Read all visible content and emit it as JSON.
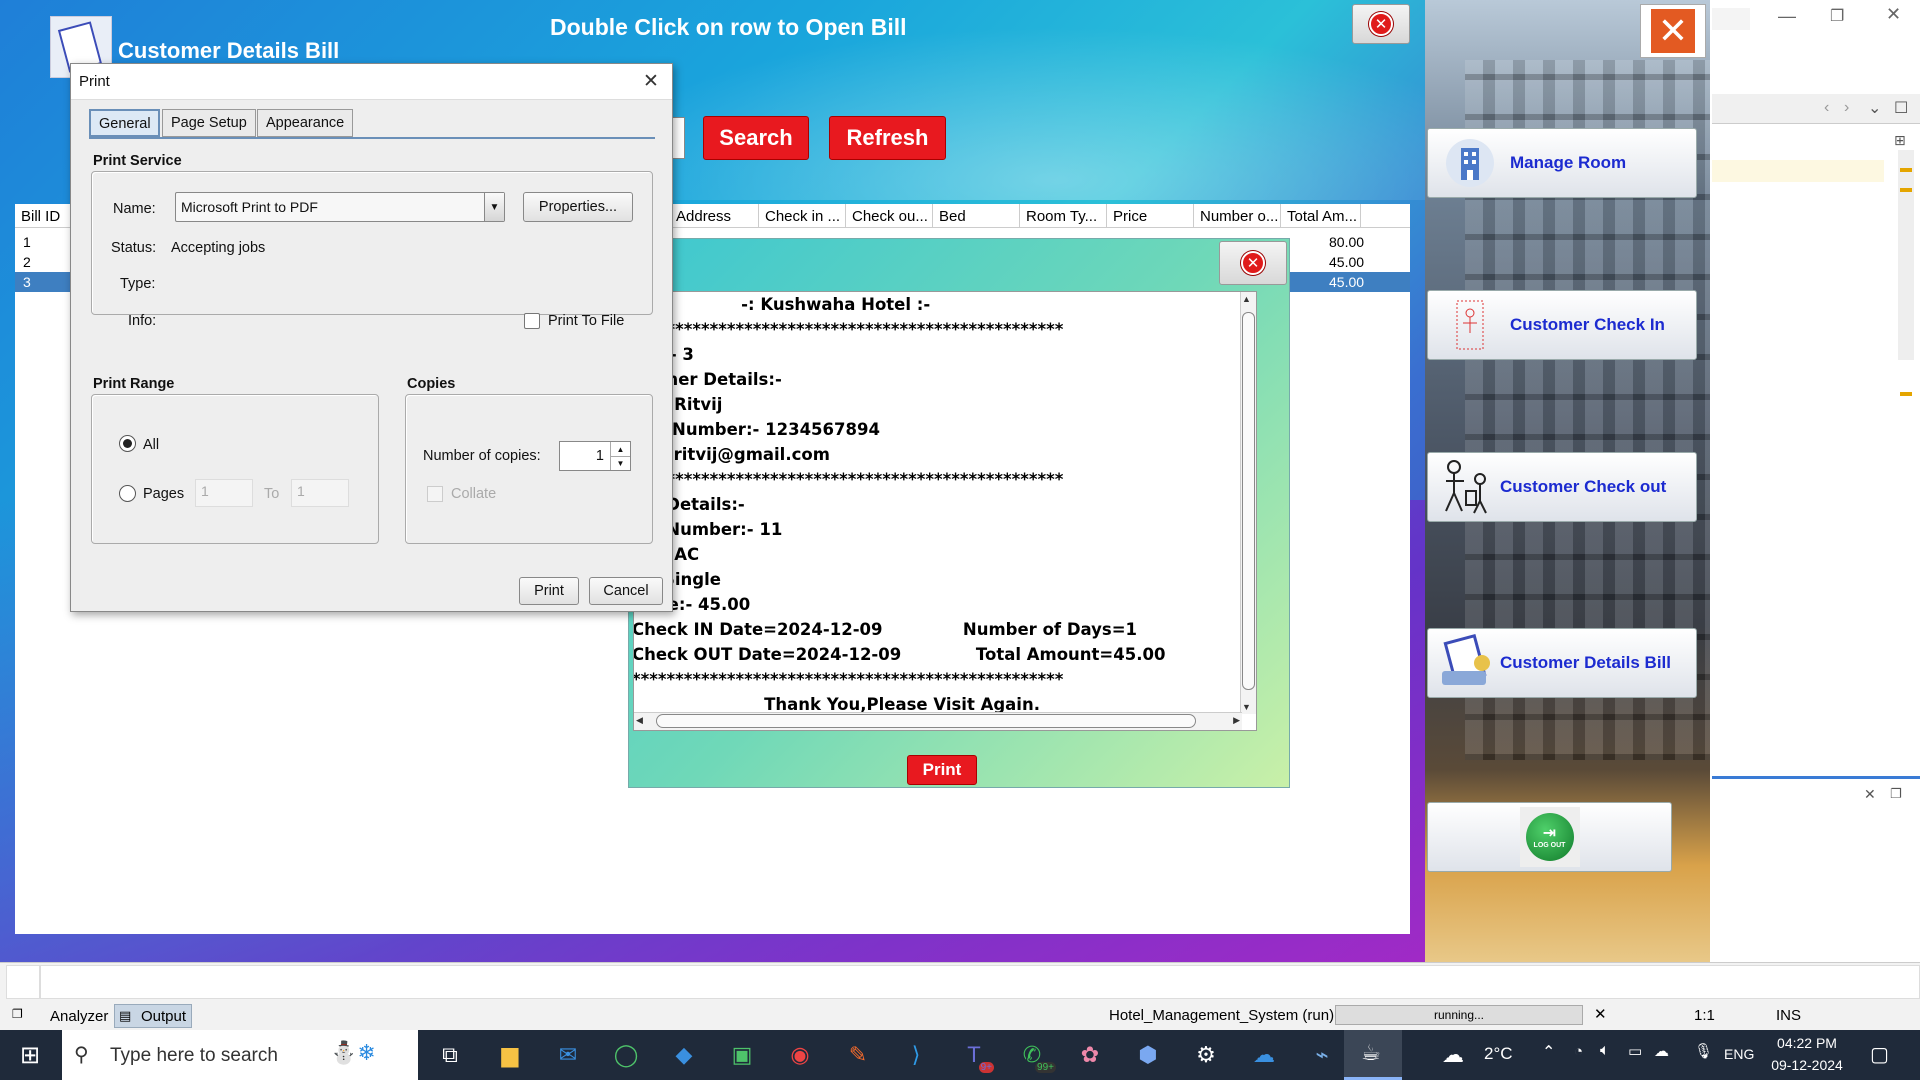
{
  "app": {
    "title": "Customer Details Bill",
    "hint": "Double Click on row to Open Bill",
    "search_label": "Search",
    "refresh_label": "Refresh"
  },
  "table": {
    "columns": [
      "Bill ID",
      "Address",
      "Check in ...",
      "Check ou...",
      "Bed",
      "Room Ty...",
      "Price",
      "Number o...",
      "Total Am..."
    ],
    "rows": [
      {
        "bill_id": "1",
        "total": "80.00"
      },
      {
        "bill_id": "2",
        "total": "45.00"
      },
      {
        "bill_id": "3",
        "total": "45.00"
      }
    ]
  },
  "nav": {
    "items": [
      {
        "label": "Manage Room",
        "icon": "building-icon"
      },
      {
        "label": "Customer Check In",
        "icon": "door-icon"
      },
      {
        "label": "Customer Check out",
        "icon": "luggage-icon"
      },
      {
        "label": "Customer Details Bill",
        "icon": "bill-icon"
      }
    ],
    "logout_label": "LOG OUT"
  },
  "bill": {
    "print_label": "Print",
    "text": "                   -: Kushwaha Hotel :-\n**************************************************\nl ID:- 3\nstomer Details:-\nne:- Ritvij\nbile Number:- 1234567894\nail:- ritvij@gmail.com\n**************************************************\nom Details:-\nom Number:- 11\npe:- AC\nd:- Single\nPrice:- 45.00\nCheck IN Date=2024-12-09              Number of Days=1\nCheck OUT Date=2024-12-09             Total Amount=45.00\n**************************************************\n                       Thank You,Please Visit Again."
  },
  "print_dialog": {
    "title": "Print",
    "tabs": [
      "General",
      "Page Setup",
      "Appearance"
    ],
    "print_service": "Print Service",
    "name_label": "Name:",
    "printer_name": "Microsoft Print to PDF",
    "properties_label": "Properties...",
    "status_label": "Status:",
    "status_value": "Accepting jobs",
    "type_label": "Type:",
    "info_label": "Info:",
    "print_to_file": "Print To File",
    "print_range": "Print Range",
    "all_label": "All",
    "pages_label": "Pages",
    "pages_from": "1",
    "to_label": "To",
    "pages_to": "1",
    "copies": "Copies",
    "copies_label": "Number of copies:",
    "copies_value": "1",
    "collate_label": "Collate",
    "print_button": "Print",
    "cancel_button": "Cancel"
  },
  "status_bar": {
    "analyzer": "Analyzer",
    "output": "Output",
    "run": "Hotel_Management_System (run)",
    "running": "running...",
    "position": "1:1",
    "mode": "INS"
  },
  "taskbar": {
    "search_placeholder": "Type here to search",
    "weather": "2°C",
    "lang": "ENG",
    "time": "04:22 PM",
    "date": "09-12-2024",
    "badge_teams": "9+",
    "badge_whatsapp": "99+"
  },
  "colors": {
    "accent_red": "#e8191f",
    "nav_text": "#1c2bd0",
    "selected_row": "#3e7fc1"
  }
}
